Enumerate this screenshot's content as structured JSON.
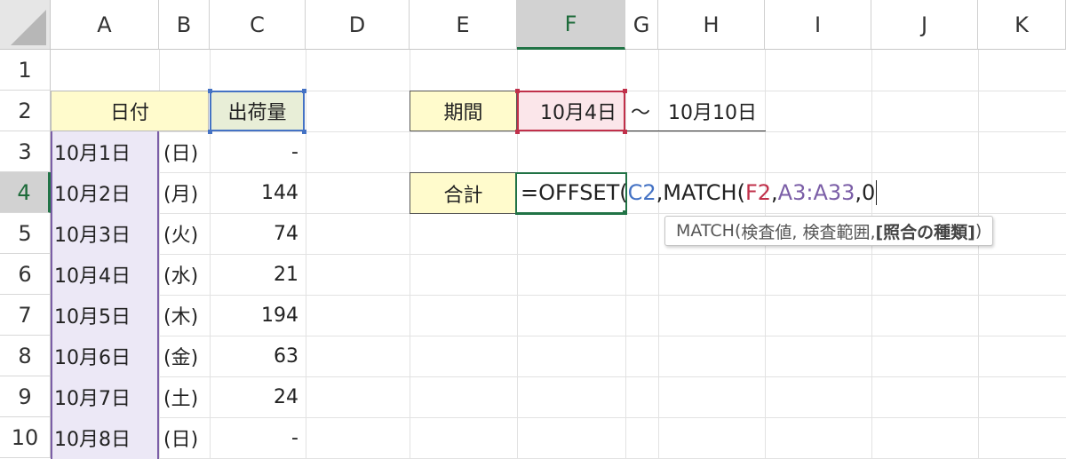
{
  "sheet": {
    "columns": [
      "A",
      "B",
      "C",
      "D",
      "E",
      "F",
      "G",
      "H",
      "I",
      "J",
      "K"
    ],
    "selected_column": "F",
    "rows": [
      "1",
      "2",
      "3",
      "4",
      "5",
      "6",
      "7",
      "8",
      "9",
      "10"
    ],
    "selected_row": "4"
  },
  "table": {
    "header_date": "日付",
    "header_qty": "出荷量",
    "rows": [
      {
        "date": "10月1日",
        "weekday": "(日)",
        "qty": "-"
      },
      {
        "date": "10月2日",
        "weekday": "(月)",
        "qty": "144"
      },
      {
        "date": "10月3日",
        "weekday": "(火)",
        "qty": "74"
      },
      {
        "date": "10月4日",
        "weekday": "(水)",
        "qty": "21"
      },
      {
        "date": "10月5日",
        "weekday": "(木)",
        "qty": "194"
      },
      {
        "date": "10月6日",
        "weekday": "(金)",
        "qty": "63"
      },
      {
        "date": "10月7日",
        "weekday": "(土)",
        "qty": "24"
      },
      {
        "date": "10月8日",
        "weekday": "(日)",
        "qty": "-"
      }
    ]
  },
  "period": {
    "label": "期間",
    "start": "10月4日",
    "tilde": "～",
    "end": "10月10日"
  },
  "total": {
    "label": "合計",
    "formula_parts": [
      {
        "text": "=OFFSET(",
        "color": "black"
      },
      {
        "text": "C2",
        "color": "blue"
      },
      {
        "text": ",MATCH(",
        "color": "black"
      },
      {
        "text": "F2",
        "color": "red"
      },
      {
        "text": ",",
        "color": "black"
      },
      {
        "text": "A3:A33",
        "color": "purple"
      },
      {
        "text": ",0",
        "color": "black"
      }
    ]
  },
  "tooltip": {
    "func": "MATCH(",
    "args": "検査値, 検査範囲, ",
    "optional": "[照合の種類]",
    "close": ")"
  },
  "colors": {
    "selection_green": "#217346",
    "ref_blue": "#4472c4",
    "ref_red": "#c0304a",
    "ref_purple": "#7b5ea7",
    "header_yellow": "#fffbcc"
  }
}
